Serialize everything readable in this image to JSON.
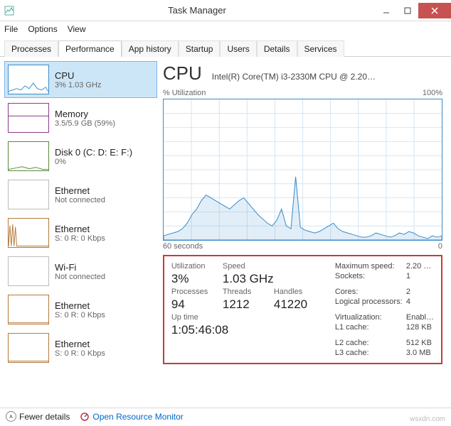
{
  "window": {
    "title": "Task Manager"
  },
  "menu": {
    "file": "File",
    "options": "Options",
    "view": "View"
  },
  "tabs": {
    "processes": "Processes",
    "performance": "Performance",
    "app_history": "App history",
    "startup": "Startup",
    "users": "Users",
    "details": "Details",
    "services": "Services"
  },
  "sidebar": {
    "items": [
      {
        "title": "CPU",
        "sub": "3% 1.03 GHz",
        "color": "#3a8cc9"
      },
      {
        "title": "Memory",
        "sub": "3.5/5.9 GB (59%)",
        "color": "#8a3a8c"
      },
      {
        "title": "Disk 0 (C: D: E: F:)",
        "sub": "0%",
        "color": "#5a8a3a"
      },
      {
        "title": "Ethernet",
        "sub": "Not connected",
        "color": "#bbb"
      },
      {
        "title": "Ethernet",
        "sub": "S: 0 R: 0 Kbps",
        "color": "#b57a3a"
      },
      {
        "title": "Wi-Fi",
        "sub": "Not connected",
        "color": "#bbb"
      },
      {
        "title": "Ethernet",
        "sub": "S: 0 R: 0 Kbps",
        "color": "#b57a3a"
      },
      {
        "title": "Ethernet",
        "sub": "S: 0 R: 0 Kbps",
        "color": "#b57a3a"
      }
    ]
  },
  "chart_data": {
    "type": "area",
    "title": "% Utilization",
    "ylim": [
      0,
      100
    ],
    "xrange_label_left": "60 seconds",
    "xrange_label_right": "0",
    "max_label": "100%",
    "series": [
      {
        "name": "CPU",
        "values": [
          3,
          4,
          5,
          6,
          8,
          12,
          18,
          22,
          28,
          32,
          30,
          28,
          26,
          24,
          22,
          25,
          28,
          30,
          26,
          22,
          18,
          15,
          12,
          10,
          14,
          22,
          10,
          8,
          45,
          9,
          7,
          6,
          5,
          6,
          8,
          10,
          12,
          8,
          6,
          5,
          4,
          3,
          2,
          2,
          3,
          5,
          4,
          3,
          2,
          3,
          5,
          4,
          6,
          5,
          3,
          2,
          1,
          3,
          2,
          3
        ]
      }
    ]
  },
  "header": {
    "title": "CPU",
    "sub": "Intel(R) Core(TM) i3-2330M CPU @ 2.20…"
  },
  "details": {
    "utilization_label": "Utilization",
    "utilization": "3%",
    "speed_label": "Speed",
    "speed": "1.03 GHz",
    "processes_label": "Processes",
    "processes": "94",
    "threads_label": "Threads",
    "threads": "1212",
    "handles_label": "Handles",
    "handles": "41220",
    "uptime_label": "Up time",
    "uptime": "1:05:46:08",
    "max_speed_label": "Maximum speed:",
    "max_speed": "2.20 …",
    "sockets_label": "Sockets:",
    "sockets": "1",
    "cores_label": "Cores:",
    "cores": "2",
    "lp_label": "Logical processors:",
    "lp": "4",
    "virt_label": "Virtualization:",
    "virt": "Enabl…",
    "l1_label": "L1 cache:",
    "l1": "128 KB",
    "l2_label": "L2 cache:",
    "l2": "512 KB",
    "l3_label": "L3 cache:",
    "l3": "3.0 MB"
  },
  "footer": {
    "fewer": "Fewer details",
    "resource_monitor": "Open Resource Monitor"
  },
  "watermark": "wsxdn.com"
}
